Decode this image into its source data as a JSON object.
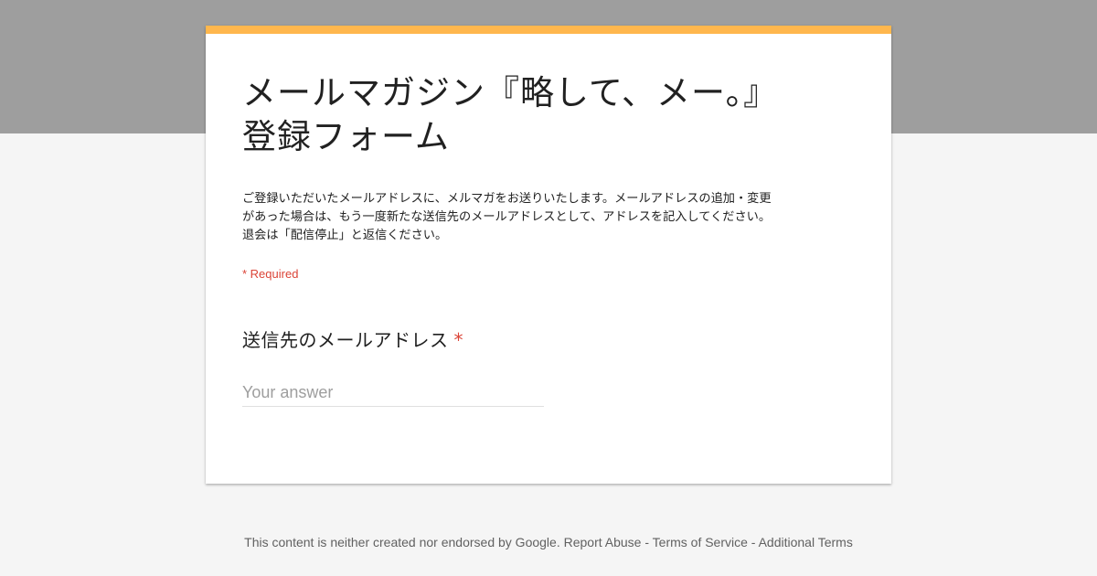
{
  "form": {
    "title": "メールマガジン『略して、メー。』\n登録フォーム",
    "description": "ご登録いただいたメールアドレスに、メルマガをお送りいたします。メールアドレスの追加・変更\nがあった場合は、もう一度新たな送信先のメールアドレスとして、アドレスを記入してください。\n退会は「配信停止」と返信ください。",
    "required_note": "* Required",
    "question": {
      "label": "送信先のメールアドレス",
      "required_star": "*",
      "placeholder": "Your answer"
    }
  },
  "footer": {
    "disclaimer": "This content is neither created nor endorsed by Google.",
    "report_abuse": "Report Abuse",
    "sep1": " - ",
    "terms_of_service": "Terms of Service",
    "sep2": " - ",
    "additional_terms": "Additional Terms"
  },
  "colors": {
    "header_band": "#9e9e9e",
    "accent": "#ffb74d",
    "required_red": "#db4437",
    "background": "#f5f5f5"
  }
}
